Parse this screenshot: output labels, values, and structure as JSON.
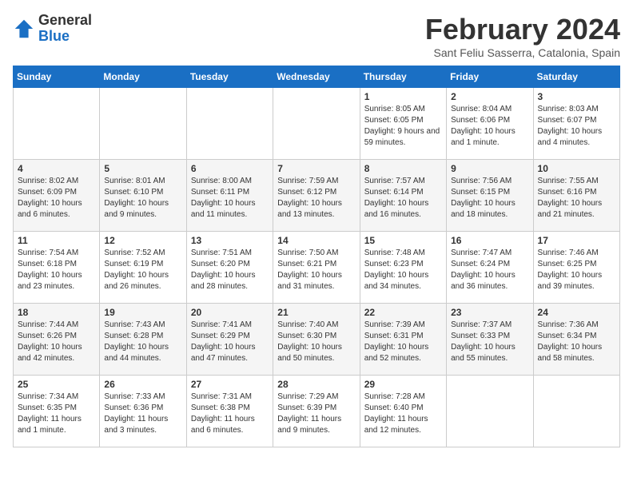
{
  "logo": {
    "general": "General",
    "blue": "Blue"
  },
  "title": "February 2024",
  "location": "Sant Feliu Sasserra, Catalonia, Spain",
  "days_of_week": [
    "Sunday",
    "Monday",
    "Tuesday",
    "Wednesday",
    "Thursday",
    "Friday",
    "Saturday"
  ],
  "weeks": [
    [
      {
        "day": "",
        "info": ""
      },
      {
        "day": "",
        "info": ""
      },
      {
        "day": "",
        "info": ""
      },
      {
        "day": "",
        "info": ""
      },
      {
        "day": "1",
        "info": "Sunrise: 8:05 AM\nSunset: 6:05 PM\nDaylight: 9 hours and 59 minutes."
      },
      {
        "day": "2",
        "info": "Sunrise: 8:04 AM\nSunset: 6:06 PM\nDaylight: 10 hours and 1 minute."
      },
      {
        "day": "3",
        "info": "Sunrise: 8:03 AM\nSunset: 6:07 PM\nDaylight: 10 hours and 4 minutes."
      }
    ],
    [
      {
        "day": "4",
        "info": "Sunrise: 8:02 AM\nSunset: 6:09 PM\nDaylight: 10 hours and 6 minutes."
      },
      {
        "day": "5",
        "info": "Sunrise: 8:01 AM\nSunset: 6:10 PM\nDaylight: 10 hours and 9 minutes."
      },
      {
        "day": "6",
        "info": "Sunrise: 8:00 AM\nSunset: 6:11 PM\nDaylight: 10 hours and 11 minutes."
      },
      {
        "day": "7",
        "info": "Sunrise: 7:59 AM\nSunset: 6:12 PM\nDaylight: 10 hours and 13 minutes."
      },
      {
        "day": "8",
        "info": "Sunrise: 7:57 AM\nSunset: 6:14 PM\nDaylight: 10 hours and 16 minutes."
      },
      {
        "day": "9",
        "info": "Sunrise: 7:56 AM\nSunset: 6:15 PM\nDaylight: 10 hours and 18 minutes."
      },
      {
        "day": "10",
        "info": "Sunrise: 7:55 AM\nSunset: 6:16 PM\nDaylight: 10 hours and 21 minutes."
      }
    ],
    [
      {
        "day": "11",
        "info": "Sunrise: 7:54 AM\nSunset: 6:18 PM\nDaylight: 10 hours and 23 minutes."
      },
      {
        "day": "12",
        "info": "Sunrise: 7:52 AM\nSunset: 6:19 PM\nDaylight: 10 hours and 26 minutes."
      },
      {
        "day": "13",
        "info": "Sunrise: 7:51 AM\nSunset: 6:20 PM\nDaylight: 10 hours and 28 minutes."
      },
      {
        "day": "14",
        "info": "Sunrise: 7:50 AM\nSunset: 6:21 PM\nDaylight: 10 hours and 31 minutes."
      },
      {
        "day": "15",
        "info": "Sunrise: 7:48 AM\nSunset: 6:23 PM\nDaylight: 10 hours and 34 minutes."
      },
      {
        "day": "16",
        "info": "Sunrise: 7:47 AM\nSunset: 6:24 PM\nDaylight: 10 hours and 36 minutes."
      },
      {
        "day": "17",
        "info": "Sunrise: 7:46 AM\nSunset: 6:25 PM\nDaylight: 10 hours and 39 minutes."
      }
    ],
    [
      {
        "day": "18",
        "info": "Sunrise: 7:44 AM\nSunset: 6:26 PM\nDaylight: 10 hours and 42 minutes."
      },
      {
        "day": "19",
        "info": "Sunrise: 7:43 AM\nSunset: 6:28 PM\nDaylight: 10 hours and 44 minutes."
      },
      {
        "day": "20",
        "info": "Sunrise: 7:41 AM\nSunset: 6:29 PM\nDaylight: 10 hours and 47 minutes."
      },
      {
        "day": "21",
        "info": "Sunrise: 7:40 AM\nSunset: 6:30 PM\nDaylight: 10 hours and 50 minutes."
      },
      {
        "day": "22",
        "info": "Sunrise: 7:39 AM\nSunset: 6:31 PM\nDaylight: 10 hours and 52 minutes."
      },
      {
        "day": "23",
        "info": "Sunrise: 7:37 AM\nSunset: 6:33 PM\nDaylight: 10 hours and 55 minutes."
      },
      {
        "day": "24",
        "info": "Sunrise: 7:36 AM\nSunset: 6:34 PM\nDaylight: 10 hours and 58 minutes."
      }
    ],
    [
      {
        "day": "25",
        "info": "Sunrise: 7:34 AM\nSunset: 6:35 PM\nDaylight: 11 hours and 1 minute."
      },
      {
        "day": "26",
        "info": "Sunrise: 7:33 AM\nSunset: 6:36 PM\nDaylight: 11 hours and 3 minutes."
      },
      {
        "day": "27",
        "info": "Sunrise: 7:31 AM\nSunset: 6:38 PM\nDaylight: 11 hours and 6 minutes."
      },
      {
        "day": "28",
        "info": "Sunrise: 7:29 AM\nSunset: 6:39 PM\nDaylight: 11 hours and 9 minutes."
      },
      {
        "day": "29",
        "info": "Sunrise: 7:28 AM\nSunset: 6:40 PM\nDaylight: 11 hours and 12 minutes."
      },
      {
        "day": "",
        "info": ""
      },
      {
        "day": "",
        "info": ""
      }
    ]
  ]
}
